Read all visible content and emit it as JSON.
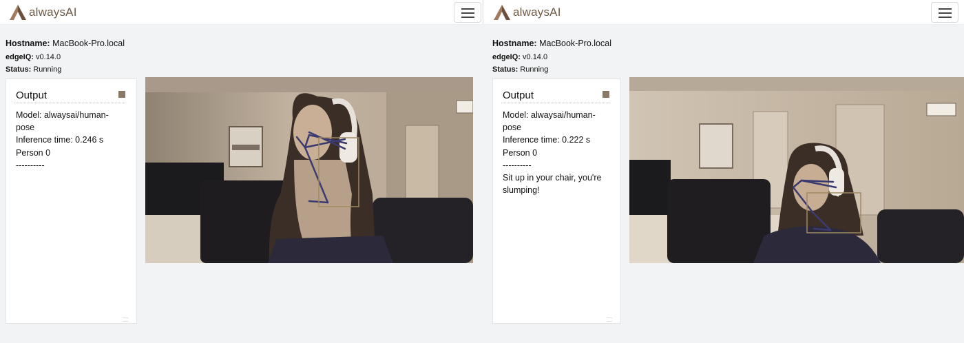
{
  "brand": {
    "name": "alwaysAI",
    "color": "#6f5b45",
    "logo_icon": "alwaysai-logo-icon",
    "menu_icon": "hamburger-menu-icon"
  },
  "panels": [
    {
      "hostname_label": "Hostname:",
      "hostname": "MacBook-Pro.local",
      "edgeiq_label": "edgeIQ:",
      "edgeiq_version": "v0.14.0",
      "status_label": "Status:",
      "status": "Running",
      "output": {
        "title": "Output",
        "stop_icon": "stop-square-icon",
        "lines": [
          "Model: alwaysai/human-pose",
          "Inference time: 0.246 s",
          "Person 0",
          "----------"
        ]
      },
      "video": {
        "icon": "pose-estimation-video-frame",
        "scene": "upright"
      }
    },
    {
      "hostname_label": "Hostname:",
      "hostname": "MacBook-Pro.local",
      "edgeiq_label": "edgeIQ:",
      "edgeiq_version": "v0.14.0",
      "status_label": "Status:",
      "status": "Running",
      "output": {
        "title": "Output",
        "stop_icon": "stop-square-icon",
        "lines": [
          "Model: alwaysai/human-pose",
          "Inference time: 0.222 s",
          "Person 0",
          "----------",
          "Sit up in your chair, you're slumping!"
        ]
      },
      "video": {
        "icon": "pose-estimation-video-frame",
        "scene": "slumped"
      }
    }
  ],
  "colors": {
    "page_bg": "#f2f3f5",
    "skeleton": "#3a3a70",
    "keypoint_box": "#a08a62",
    "stop_square": "#8b7967"
  }
}
